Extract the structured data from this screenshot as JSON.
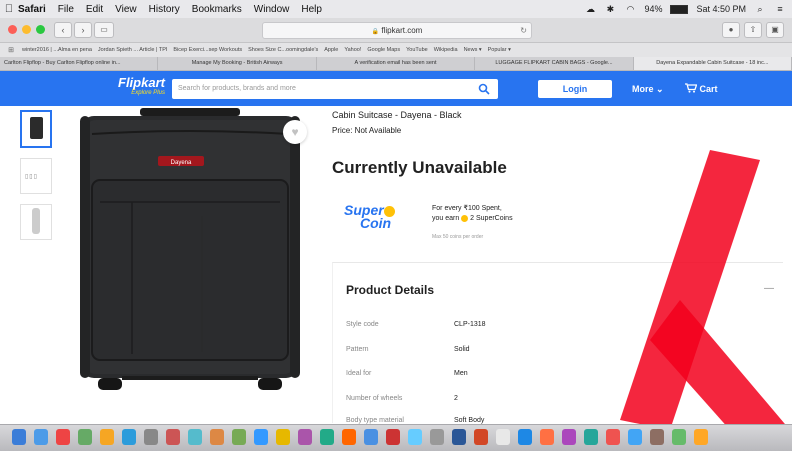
{
  "menubar": {
    "app": "Safari",
    "items": [
      "File",
      "Edit",
      "View",
      "History",
      "Bookmarks",
      "Window",
      "Help"
    ],
    "battery": "94%",
    "battery_level": 0.94,
    "clock": "Sat 4:50 PM"
  },
  "toolbar": {
    "url": "flipkart.com",
    "lock_glyph": "🔒"
  },
  "favorites": [
    "winter2016 | ...Alma en pena",
    "Jordan Spieth ... Article | TPI",
    "Bicep Exerci...sep Workouts",
    "Shoes Size C...oomingdale's",
    "Apple",
    "Yahoo!",
    "Google Maps",
    "YouTube",
    "Wikipedia",
    "News ▾",
    "Popular ▾"
  ],
  "tabs": [
    "Carlton Flipflop - Buy Carlton Flipflop online in...",
    "Manage My Booking - British Airways",
    "A verification email has been sent",
    "LUGGAGE FLIPKART CABIN BAGS - Google...",
    "Dayena Expandable Cabin Suitcase - 18 inc..."
  ],
  "active_tab": 4,
  "header": {
    "logo": "Flipkart",
    "logo_sub": "Explore Plus",
    "search_placeholder": "Search for products, brands and more",
    "login": "Login",
    "more": "More ⌄",
    "cart": "Cart",
    "color": "#2874f0"
  },
  "product": {
    "title": "Cabin Suitcase - Dayena - Black",
    "price": "Price: Not Available",
    "status": "Currently Unavailable",
    "brand_label": "Dayena"
  },
  "supercoin": {
    "logo_l1": "Super",
    "logo_l2": "Coin",
    "line1": "For every ₹100 Spent,",
    "line2_pre": "you earn",
    "line2_post": "2 SuperCoins",
    "note": "Max 50 coins per order"
  },
  "details": {
    "heading": "Product Details",
    "specs": [
      {
        "label": "Style code",
        "value": "CLP-1318"
      },
      {
        "label": "Pattern",
        "value": "Solid"
      },
      {
        "label": "Ideal for",
        "value": "Men"
      },
      {
        "label": "Number of wheels",
        "value": "2"
      },
      {
        "label": "Body type material",
        "value": "Soft Body"
      }
    ]
  },
  "dock_colors": [
    "#3b7dd8",
    "#4c9be8",
    "#e44",
    "#6a6",
    "#f6a623",
    "#2c9cdb",
    "#888",
    "#c55",
    "#5bc",
    "#d84",
    "#7a5",
    "#39f",
    "#e6b800",
    "#a5a",
    "#2a8",
    "#f60",
    "#4a90e2",
    "#c33",
    "#6cf",
    "#999",
    "#2b5797",
    "#d24726",
    "#e8e8e8",
    "#1e88e5",
    "#ff7043",
    "#ab47bc",
    "#26a69a",
    "#ef5350",
    "#42a5f5",
    "#8d6e63",
    "#66bb6a",
    "#ffa726"
  ],
  "icons": {
    "apple": "apple-icon",
    "search": "search-icon",
    "cart": "cart-icon",
    "heart": "heart-icon"
  }
}
